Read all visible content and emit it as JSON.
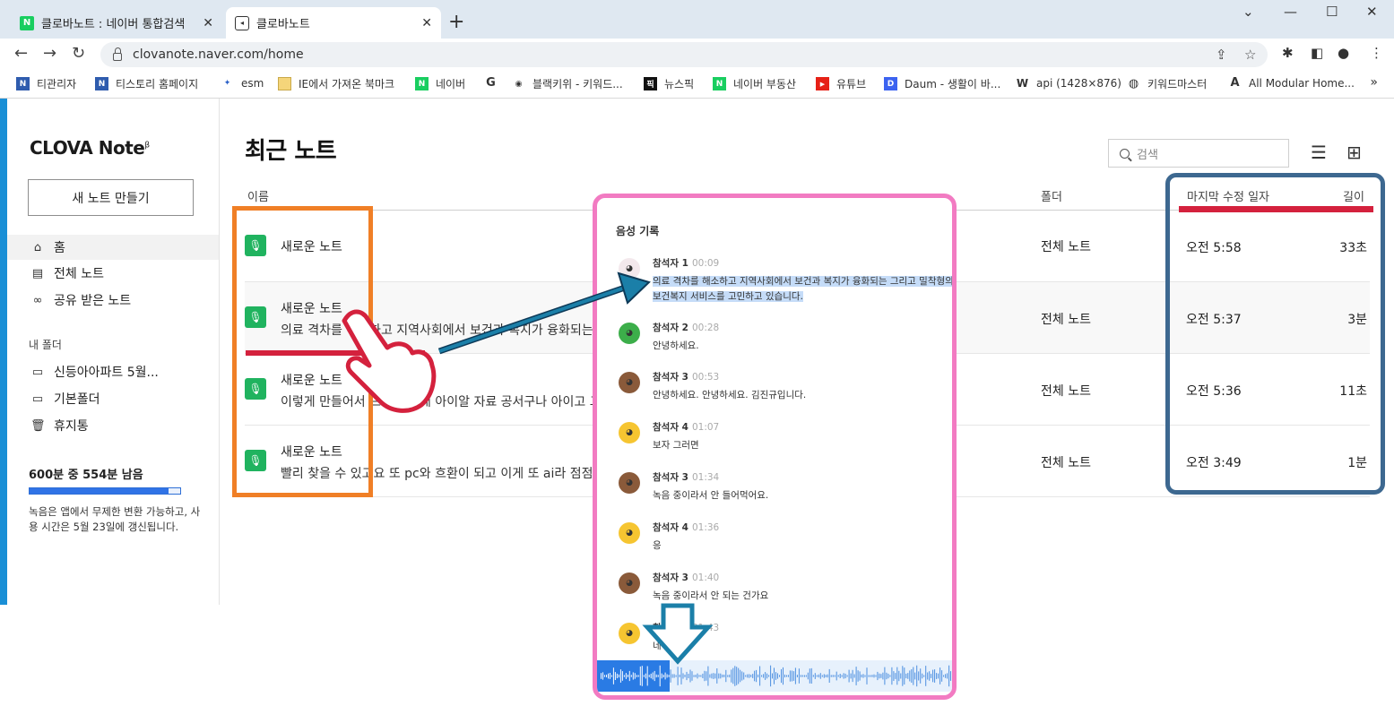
{
  "browser": {
    "tabs": [
      {
        "title": "클로바노트 : 네이버 통합검색"
      },
      {
        "title": "클로바노트"
      }
    ],
    "new_tab": "+",
    "window_controls": [
      "⌄",
      "—",
      "☐",
      "✕"
    ],
    "url": "clovanote.naver.com/home",
    "bookmarks": [
      {
        "label": "티관리자"
      },
      {
        "label": "티스토리 홈페이지"
      },
      {
        "label": "esm"
      },
      {
        "label": "IE에서 가져온 북마크"
      },
      {
        "label": "네이버"
      },
      {
        "label": ""
      },
      {
        "label": "블랙키위 - 키워드..."
      },
      {
        "label": "뉴스픽"
      },
      {
        "label": "네이버 부동산"
      },
      {
        "label": "유튜브"
      },
      {
        "label": "Daum - 생활이 바..."
      },
      {
        "label": "api (1428×876)"
      },
      {
        "label": "키워드마스터"
      },
      {
        "label": "All Modular Home..."
      }
    ],
    "bookmarks_more": "»"
  },
  "sidebar": {
    "logo": "CLOVA Note",
    "logo_sup": "β",
    "new_note_button": "새 노트 만들기",
    "nav": [
      {
        "label": "홈"
      },
      {
        "label": "전체 노트"
      },
      {
        "label": "공유 받은 노트"
      }
    ],
    "folders_heading": "내 폴더",
    "folders": [
      {
        "label": "신등아아파트 5월..."
      },
      {
        "label": "기본폴더"
      },
      {
        "label": "휴지통"
      }
    ],
    "usage": {
      "text": "600분 중 554분 남음",
      "remaining_fraction": 0.923,
      "note": "녹음은 앱에서 무제한 변환 가능하고, 사용 시간은 5월 23일에 갱신됩니다."
    }
  },
  "main": {
    "title": "최근 노트",
    "search_placeholder": "검색",
    "columns": {
      "name": "이름",
      "folder": "폴더",
      "date": "마지막 수정 일자",
      "length": "길이"
    },
    "notes": [
      {
        "title": "새로운 노트",
        "preview": "",
        "folder": "전체 노트",
        "date": "오전 5:58",
        "length": "33초"
      },
      {
        "title": "새로운 노트",
        "preview": "의료 격차를 해소하고 지역사회에서 보건과 복지가 융화되는 그리고 밀착형의 보건복지 서비스를 고민하고 있…",
        "folder": "전체 노트",
        "date": "오전 5:37",
        "length": "3분"
      },
      {
        "title": "새로운 노트",
        "preview": "이렇게 만들어서 드리면 되게 아이알 자료 공서구나 아이고 그러면 이제 이거를 하나씩 정리해서 저 쪽 추…",
        "folder": "전체 노트",
        "date": "오전 5:36",
        "length": "11초"
      },
      {
        "title": "새로운 노트",
        "preview": "빨리 찾을 수 있고요 또 pc와 흐환이 되고 이게 또 ai라 점점 똑똑해지니까 이제 더 많이 쓰면 좋겠어요 토어…",
        "folder": "전체 노트",
        "date": "오전 3:49",
        "length": "1분"
      }
    ]
  },
  "transcript": {
    "title": "음성 기록",
    "played_fraction": 0.2,
    "messages": [
      {
        "speaker": "참석자 1",
        "time": "00:09",
        "text": "의료 격차를 해소하고 지역사회에서 보건과 복지가 융화되는 그리고 밀착형의 보건복지 서비스를 고민하고 있습니다.",
        "avatar_color": "#f3e8ec"
      },
      {
        "speaker": "참석자 2",
        "time": "00:28",
        "text": "안녕하세요.",
        "avatar_color": "#3cae4a"
      },
      {
        "speaker": "참석자 3",
        "time": "00:53",
        "text": "안녕하세요. 안녕하세요. 김진규입니다.",
        "avatar_color": "#8a5a3a"
      },
      {
        "speaker": "참석자 4",
        "time": "01:07",
        "text": "보자 그러면",
        "avatar_color": "#f6c531"
      },
      {
        "speaker": "참석자 3",
        "time": "01:34",
        "text": "녹음 중이라서 안 들어먹어요.",
        "avatar_color": "#8a5a3a"
      },
      {
        "speaker": "참석자 4",
        "time": "01:36",
        "text": "응",
        "avatar_color": "#f6c531"
      },
      {
        "speaker": "참석자 3",
        "time": "01:40",
        "text": "녹음 중이라서 안 되는 건가요",
        "avatar_color": "#8a5a3a"
      },
      {
        "speaker": "참석자 4",
        "time": "01:43",
        "text": "네",
        "avatar_color": "#f6c531"
      }
    ]
  },
  "colors": {
    "brand_green": "#20b35f",
    "annotation_orange": "#f07f26",
    "annotation_pink": "#f27bc2",
    "annotation_navy": "#3d6890",
    "annotation_red": "#d4213d",
    "arrow_teal": "#1b7fa8",
    "usage_blue": "#3073e6"
  },
  "icons": {
    "back": "arrow-left-icon",
    "forward": "arrow-right-icon",
    "reload": "reload-icon",
    "share": "share-icon",
    "star": "star-icon",
    "extensions": "puzzle-icon",
    "sidebar": "sidebar-icon",
    "menu": "kebab-icon",
    "list_view": "list-view-icon",
    "grid_view": "grid-view-icon",
    "mic": "mic-icon"
  }
}
